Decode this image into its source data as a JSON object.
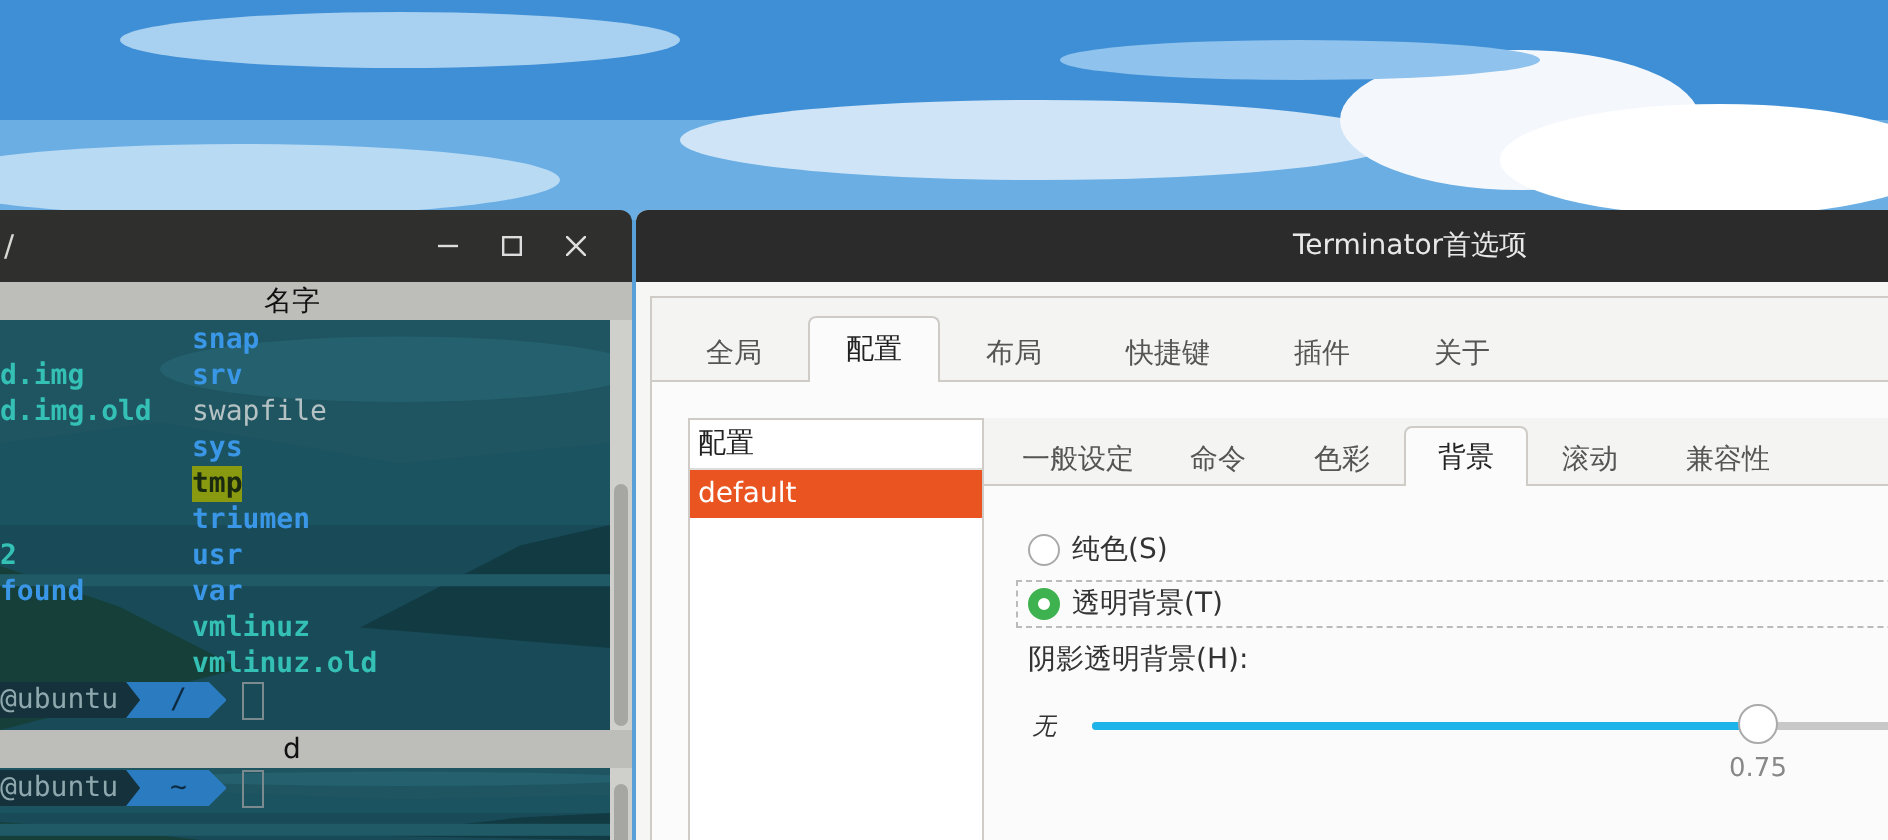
{
  "terminal": {
    "title": "/",
    "panes": [
      {
        "header": "名字",
        "rows": [
          {
            "right": {
              "name": "snap",
              "kind": "dir"
            }
          },
          {
            "left": {
              "name": "d.img",
              "kind": "link"
            },
            "right": {
              "name": "srv",
              "kind": "dir"
            }
          },
          {
            "left": {
              "name": "d.img.old",
              "kind": "link"
            },
            "right": {
              "name": "swapfile",
              "kind": "file"
            }
          },
          {
            "right": {
              "name": "sys",
              "kind": "dir"
            }
          },
          {
            "right": {
              "name": "tmp",
              "kind": "sticky"
            }
          },
          {
            "right": {
              "name": "triumen",
              "kind": "dir"
            }
          },
          {
            "left": {
              "name": "2",
              "kind": "link"
            },
            "right": {
              "name": "usr",
              "kind": "dir"
            }
          },
          {
            "left": {
              "name": "found",
              "kind": "dir"
            },
            "right": {
              "name": "var",
              "kind": "dir"
            }
          },
          {
            "right": {
              "name": "vmlinuz",
              "kind": "link"
            }
          },
          {
            "right": {
              "name": "vmlinuz.old",
              "kind": "link"
            }
          }
        ],
        "prompt": {
          "user": "@ubuntu",
          "path": "/"
        }
      },
      {
        "header": "d",
        "prompt": {
          "user": "@ubuntu",
          "path": "~"
        }
      }
    ]
  },
  "preferences": {
    "title": "Terminator首选项",
    "tabs": [
      {
        "label": "全局",
        "selected": false
      },
      {
        "label": "配置",
        "selected": true
      },
      {
        "label": "布局",
        "selected": false
      },
      {
        "label": "快捷键",
        "selected": false
      },
      {
        "label": "插件",
        "selected": false
      },
      {
        "label": "关于",
        "selected": false
      }
    ],
    "profiles": {
      "header": "配置",
      "items": [
        {
          "label": "default",
          "selected": true
        }
      ]
    },
    "profile_tabs": [
      {
        "label": "一般设定",
        "selected": false
      },
      {
        "label": "命令",
        "selected": false
      },
      {
        "label": "色彩",
        "selected": false
      },
      {
        "label": "背景",
        "selected": true
      },
      {
        "label": "滚动",
        "selected": false
      },
      {
        "label": "兼容性",
        "selected": false
      }
    ],
    "background_options": [
      {
        "label": "纯色(S)",
        "selected": false
      },
      {
        "label": "透明背景(T)",
        "selected": true
      }
    ],
    "shade": {
      "label": "阴影透明背景(H):",
      "min_label": "无",
      "level": 0.75,
      "reading": "0.75"
    }
  }
}
